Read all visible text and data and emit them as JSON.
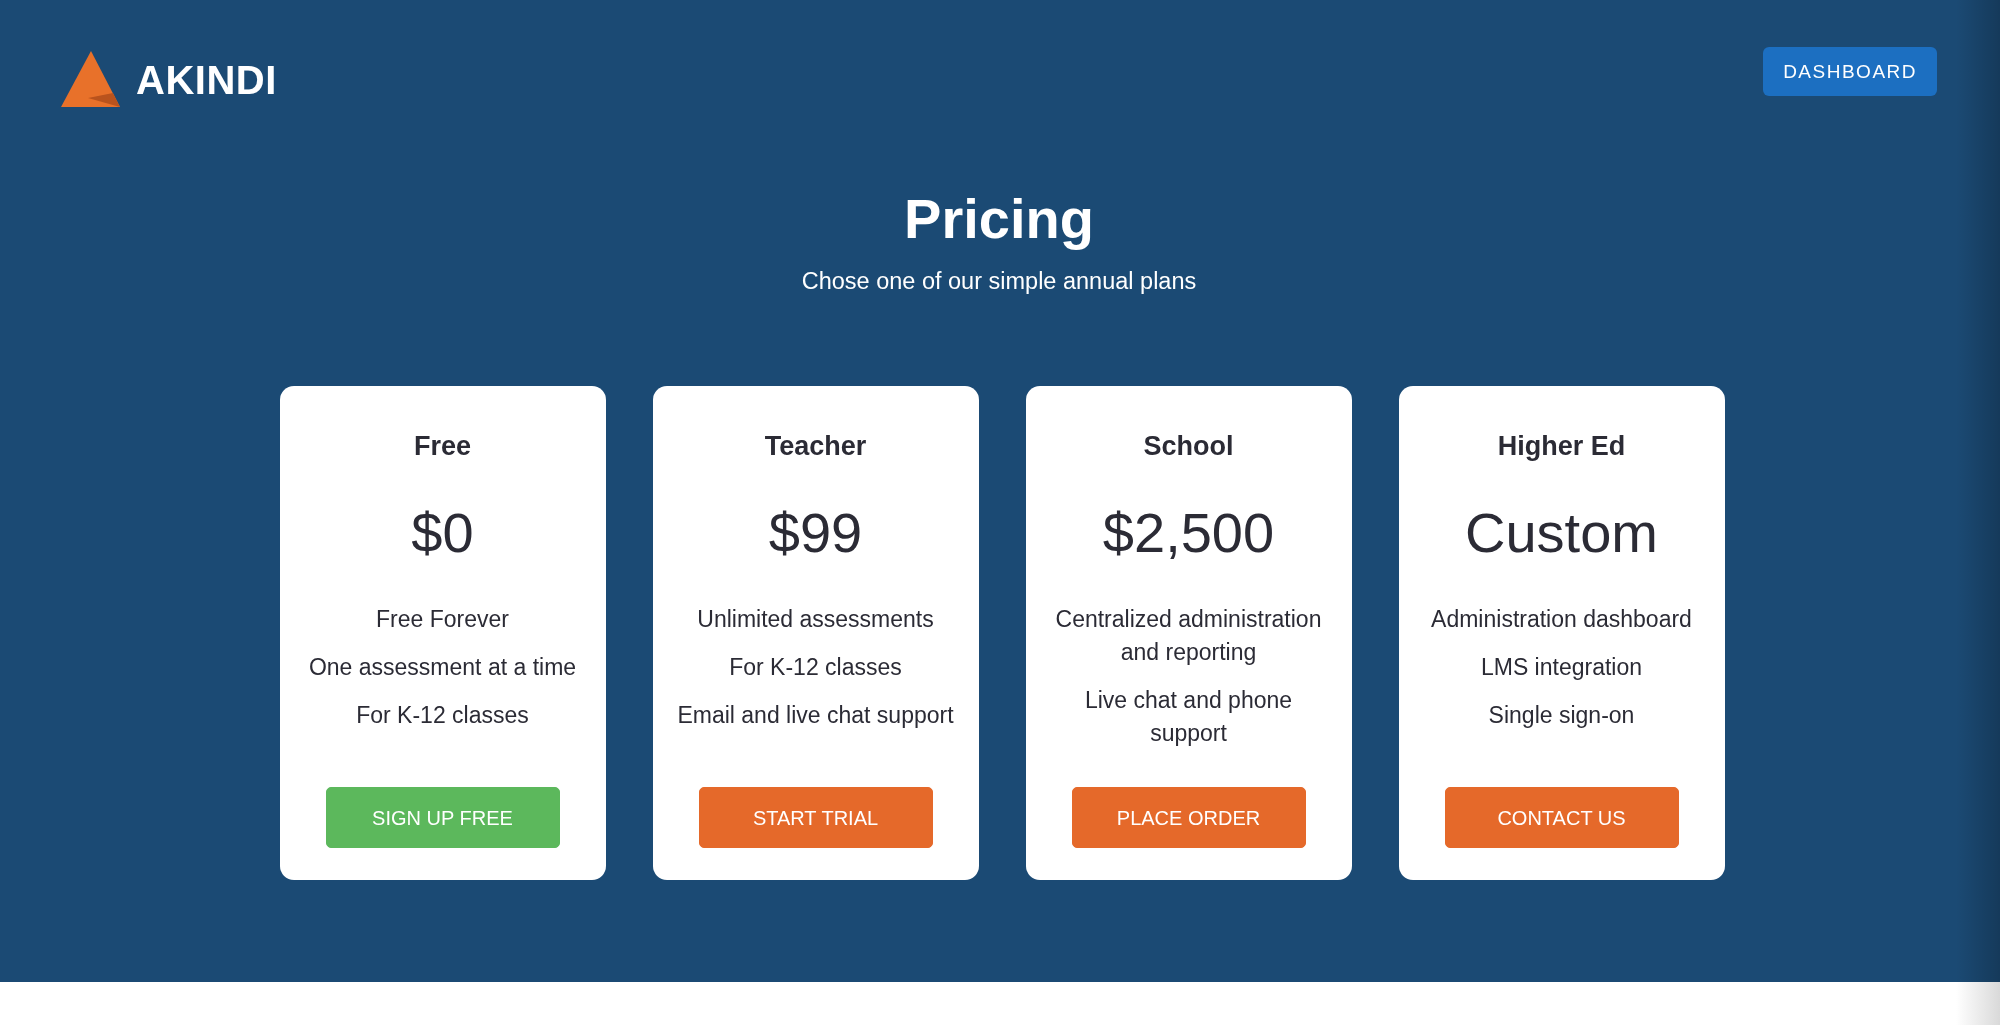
{
  "logo": {
    "text": "AKINDI"
  },
  "header_button": {
    "label": "DASHBOARD"
  },
  "heading": {
    "title": "Pricing",
    "subtitle": "Chose one of our simple annual plans"
  },
  "plans": [
    {
      "name": "Free",
      "price": "$0",
      "features": [
        "Free Forever",
        "One assessment at a time",
        "For K-12 classes"
      ],
      "button": {
        "label": "SIGN UP FREE",
        "color": "#5cb85c"
      }
    },
    {
      "name": "Teacher",
      "price": "$99",
      "features": [
        "Unlimited assessments",
        "For K-12 classes",
        "Email and live chat support"
      ],
      "button": {
        "label": "START TRIAL",
        "color": "#e5692a"
      }
    },
    {
      "name": "School",
      "price": "$2,500",
      "features": [
        "Centralized administration and reporting",
        "Live chat and phone support"
      ],
      "button": {
        "label": "PLACE ORDER",
        "color": "#e5692a"
      }
    },
    {
      "name": "Higher Ed",
      "price": "Custom",
      "features": [
        "Administration dashboard",
        "LMS integration",
        "Single sign-on"
      ],
      "button": {
        "label": "CONTACT US",
        "color": "#e5692a"
      }
    }
  ]
}
